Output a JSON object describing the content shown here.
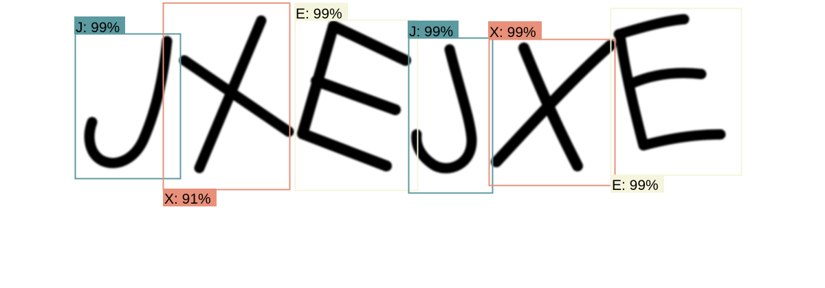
{
  "colors": {
    "background": "#ffffff",
    "glyph": "#000000",
    "J": "#5b9aa0",
    "X": "#e8907a",
    "E": "#f4f5dc"
  },
  "detections": [
    {
      "class": "J",
      "confidence": "99%",
      "label": "J: 99%"
    },
    {
      "class": "X",
      "confidence": "91%",
      "label": "X: 91%"
    },
    {
      "class": "E",
      "confidence": "99%",
      "label": "E: 99%"
    },
    {
      "class": "J",
      "confidence": "99%",
      "label": "J: 99%"
    },
    {
      "class": "X",
      "confidence": "99%",
      "label": "X: 99%"
    },
    {
      "class": "E",
      "confidence": "99%",
      "label": "E: 99%"
    }
  ]
}
